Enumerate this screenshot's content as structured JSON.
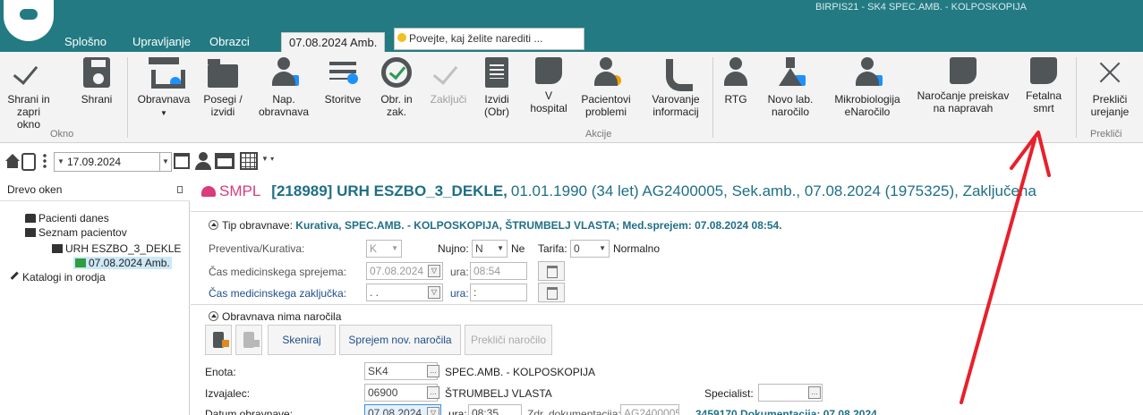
{
  "window": {
    "title": "BIRPIS21 - SK4 SPEC.AMB. - KOLPOSKOPIJA"
  },
  "tabs": [
    {
      "label": "Splošno"
    },
    {
      "label": "Upravljanje"
    },
    {
      "label": "Obrazci"
    },
    {
      "label": "07.08.2024 Amb."
    }
  ],
  "tell_me": {
    "placeholder": "Povejte, kaj želite narediti ..."
  },
  "ribbon": {
    "buttons": [
      {
        "label": "Shrani in zapri okno"
      },
      {
        "label": "Shrani"
      },
      {
        "label": "Obravnava"
      },
      {
        "label": "Posegi / izvidi"
      },
      {
        "label": "Nap. obravnava"
      },
      {
        "label": "Storitve"
      },
      {
        "label": "Obr. in zak."
      },
      {
        "label": "Zaključi"
      },
      {
        "label": "Izvidi (Obr)"
      },
      {
        "label": "V hospital"
      },
      {
        "label": "Pacientovi problemi"
      },
      {
        "label": "Varovanje informacij"
      },
      {
        "label": "RTG"
      },
      {
        "label": "Novo lab. naročilo"
      },
      {
        "label": "Mikrobiologija eNaročilo"
      },
      {
        "label": "Naročanje preiskav na napravah"
      },
      {
        "label": "Fetalna smrt"
      },
      {
        "label": "Prekliči urejanje"
      }
    ],
    "groups": {
      "okno": "Okno",
      "akcije": "Akcije",
      "preklici": "Prekliči"
    }
  },
  "toolbar2": {
    "date": "17.09.2024"
  },
  "left_panel": {
    "title": "Drevo oken",
    "tree": [
      {
        "label": "Pacienti danes"
      },
      {
        "label": "Seznam pacientov"
      },
      {
        "label": "URH ESZBO_3_DEKLE"
      },
      {
        "label": "07.08.2024 Amb."
      },
      {
        "label": "Katalogi in orodja"
      }
    ]
  },
  "header": {
    "smpl": "SMPL",
    "patient_id": "[218989] URH ESZBO_3_DEKLE,",
    "details": "01.01.1990 (34 let)  AG2400005, Sek.amb., 07.08.2024 (1975325), Zaključena"
  },
  "section1": {
    "title_label": "Tip obravnave:",
    "title_value": "Kurativa, SPEC.AMB. - KOLPOSKOPIJA, ŠTRUMBELJ VLASTA; Med.sprejem: 07.08.2024 08:54.",
    "preventiva_label": "Preventiva/Kurativa:",
    "preventiva_value": "K",
    "nujno_label": "Nujno:",
    "nujno_value": "N",
    "nujno_text": "Ne",
    "tarifa_label": "Tarifa:",
    "tarifa_value": "0",
    "tarifa_text": "Normalno",
    "cas_sprejema_label": "Čas medicinskega sprejema:",
    "cas_sprejema_date": "07.08.2024",
    "ura_label": "ura:",
    "cas_sprejema_time": "08:54",
    "cas_zakljucka_label": "Čas medicinskega zaključka:",
    "cas_zakljucka_date": ". .",
    "cas_zakljucka_time": ":"
  },
  "section2": {
    "title": "Obravnava nima naročila",
    "buttons": {
      "skeniraj": "Skeniraj",
      "sprejem": "Sprejem nov. naročila",
      "preklici": "Prekliči naročilo"
    },
    "enota_label": "Enota:",
    "enota_code": "SK4",
    "enota_name": "SPEC.AMB. - KOLPOSKOPIJA",
    "izvajalec_label": "Izvajalec:",
    "izvajalec_code": "06900",
    "izvajalec_name": "ŠTRUMBELJ VLASTA",
    "specialist_label": "Specialist:",
    "datum_label": "Datum obravnave:",
    "datum_value": "07.08.2024",
    "datum_ura": "08:35",
    "zdr_label": "Zdr. dokumentacija:",
    "zdr_value": "AG2400005",
    "dokumentacija": "3459170 Dokumentacija: 07.08.2024"
  },
  "colors": {
    "titlebar": "#237a82",
    "accent_text": "#1f6f86",
    "smpl": "#d93b7c",
    "annotation_arrow": "#e8202a"
  }
}
